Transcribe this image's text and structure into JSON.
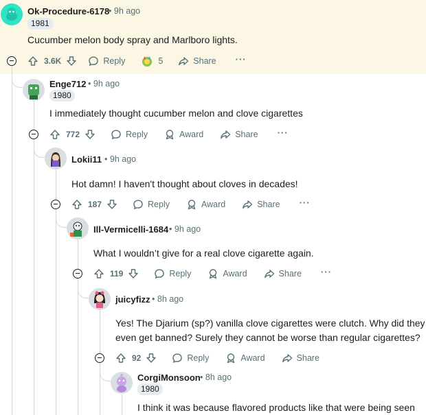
{
  "comments": [
    {
      "username": "Ok-Procedure-6178",
      "time": "9h ago",
      "flair": "1981",
      "body": "Cucumber melon body spray and Marlboro lights.",
      "score": "3.6K",
      "reply": "Reply",
      "award_count": "5",
      "share": "Share",
      "more": "···"
    },
    {
      "username": "Enge712",
      "time": "9h ago",
      "flair": "1980",
      "body": "I immediately thought cucumber melon and clove cigarettes",
      "score": "772",
      "reply": "Reply",
      "award": "Award",
      "share": "Share",
      "more": "···"
    },
    {
      "username": "Lokii11",
      "time": "9h ago",
      "body": "Hot damn! I haven't thought about cloves in decades!",
      "score": "187",
      "reply": "Reply",
      "award": "Award",
      "share": "Share",
      "more": "···"
    },
    {
      "username": "Ill-Vermicelli-1684",
      "time": "9h ago",
      "body": "What I wouldn’t give for a real clove cigarette again.",
      "score": "119",
      "reply": "Reply",
      "award": "Award",
      "share": "Share",
      "more": "···"
    },
    {
      "username": "juicyfizz",
      "time": "8h ago",
      "body_line1": "Yes! The Djarium (sp?) vanilla clove cigarettes were clutch. Why did they",
      "body_line2": "even get banned? Surely they cannot be worse than regular cigarettes?",
      "score": "92",
      "reply": "Reply",
      "award": "Award",
      "share": "Share",
      "more": "···"
    },
    {
      "username": "CorgiMonsoon",
      "time": "8h ago",
      "flair": "1980",
      "body": "I think it was because flavored products like that were being seen"
    }
  ],
  "separator": "•",
  "colors": {
    "highlight": "#fcf7e4",
    "meta": "#576f76",
    "thread_line": "#d4d7d9",
    "flair_bg": "#e5ebee"
  },
  "icons": [
    "upvote-icon",
    "downvote-icon",
    "reply-icon",
    "award-icon",
    "share-icon",
    "more-icon",
    "collapse-icon"
  ]
}
